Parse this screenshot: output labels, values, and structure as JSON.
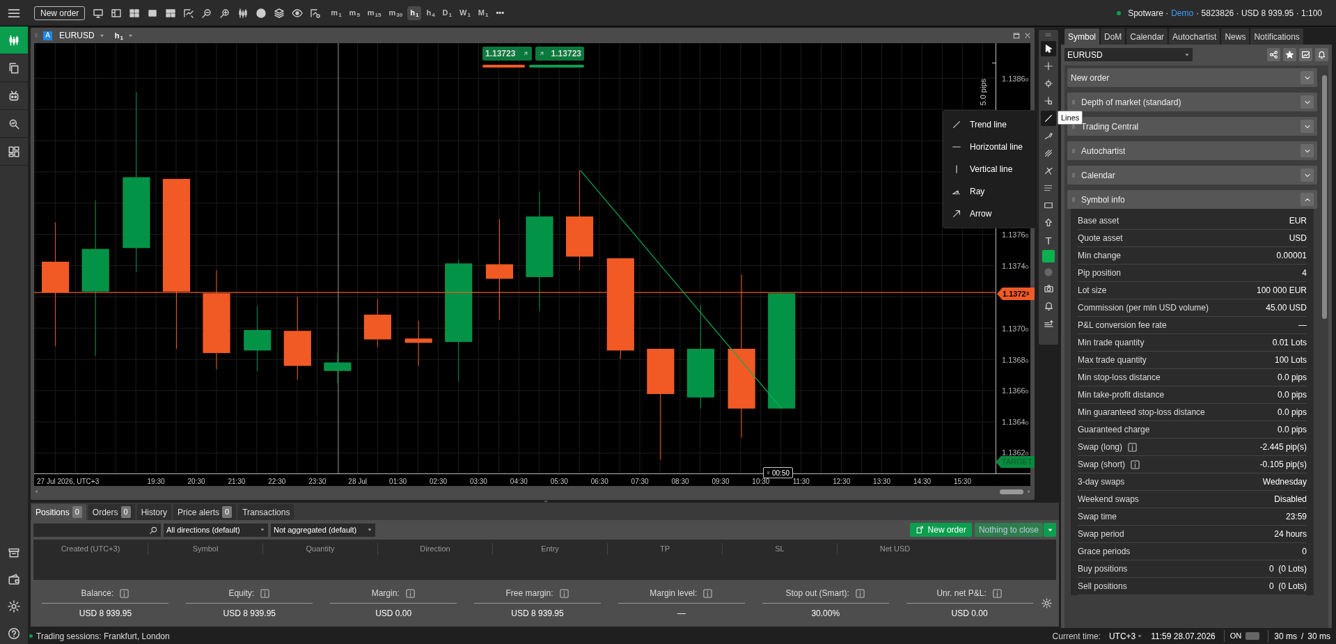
{
  "top_bar": {
    "new_order": "New order",
    "more": "•••",
    "timeframes": [
      {
        "unit": "m",
        "count": "1",
        "selected": false
      },
      {
        "unit": "m",
        "count": "5",
        "selected": false
      },
      {
        "unit": "m",
        "count": "15",
        "selected": false
      },
      {
        "unit": "m",
        "count": "30",
        "selected": false
      },
      {
        "unit": "h",
        "count": "1",
        "selected": true
      },
      {
        "unit": "h",
        "count": "4",
        "selected": false
      },
      {
        "unit": "D",
        "count": "1",
        "selected": false
      },
      {
        "unit": "W",
        "count": "1",
        "selected": false
      },
      {
        "unit": "M",
        "count": "1",
        "selected": false
      }
    ],
    "account": {
      "broker": "Spotware ·",
      "mode": "Demo",
      "details": "· 5823826 · USD 8 939.95 · 1:100"
    }
  },
  "sidebar": {
    "items": [
      {
        "selected": true
      },
      {
        "selected": false
      },
      {
        "selected": false
      },
      {
        "selected": false
      },
      {
        "selected": false
      }
    ]
  },
  "chart": {
    "symbol_badge": "A",
    "symbol": "EURUSD",
    "timeframe": {
      "unit": "h",
      "count": "1"
    },
    "sell_price": "1.13723",
    "buy_price": "1.13723",
    "range_label": "5.0 pips",
    "current_price": "1.13723",
    "target": "TARGET",
    "countdown": "00:50",
    "price_labels": [
      "1.13860",
      "1.13760",
      "1.13740",
      "1.13700",
      "1.13680",
      "1.13660",
      "1.13640",
      "1.13620"
    ],
    "date_label": "27 Jul 2026, UTC+3",
    "time_labels": [
      "19:30",
      "20:30",
      "21:30",
      "22:30",
      "23:30",
      "28 Jul",
      "01:30",
      "02:30",
      "03:30",
      "04:30",
      "05:30",
      "06:30",
      "07:30",
      "08:30",
      "09:30",
      "10:30",
      "11:30",
      "12:30",
      "13:30",
      "14:30",
      "15:30"
    ],
    "drawing_menu": [
      {
        "label": "Trend line",
        "kind": "trend"
      },
      {
        "label": "Horizontal line",
        "kind": "horizontal"
      },
      {
        "label": "Vertical line",
        "kind": "vertical"
      },
      {
        "label": "Ray",
        "kind": "ray"
      },
      {
        "label": "Arrow",
        "kind": "arrow"
      }
    ],
    "tooltip": "Lines"
  },
  "drawing_tools": {
    "text_tool": "T",
    "tools": [
      {
        "selected": true
      },
      {
        "selected": false
      },
      {
        "selected": false
      },
      {
        "selected": false
      },
      {
        "selected": true
      },
      {
        "selected": false
      },
      {
        "selected": false
      },
      {
        "selected": false
      },
      {
        "selected": false
      },
      {
        "selected": false
      },
      {
        "selected": false
      }
    ]
  },
  "right_panel": {
    "tabs": [
      {
        "label": "Symbol",
        "selected": true
      },
      {
        "label": "DoM",
        "selected": false
      },
      {
        "label": "Calendar",
        "selected": false
      },
      {
        "label": "Autochartist",
        "selected": false
      },
      {
        "label": "News",
        "selected": false
      },
      {
        "label": "Notifications",
        "selected": false
      }
    ],
    "symbol_select": "EURUSD",
    "sections": [
      {
        "title": "New order",
        "expanded": false,
        "movable": false
      },
      {
        "title": "Depth of market (standard)",
        "expanded": false,
        "movable": true
      },
      {
        "title": "Trading Central",
        "expanded": false,
        "movable": true
      },
      {
        "title": "Autochartist",
        "expanded": false,
        "movable": true
      },
      {
        "title": "Calendar",
        "expanded": false,
        "movable": true
      },
      {
        "title": "Symbol info",
        "expanded": true,
        "movable": true
      }
    ],
    "symbol_info": [
      {
        "label": "Base asset",
        "value": "EUR",
        "kind": "plain"
      },
      {
        "label": "Quote asset",
        "value": "USD",
        "kind": "plain"
      },
      {
        "label": "Min change",
        "value": "0.00001",
        "kind": "plain"
      },
      {
        "label": "Pip position",
        "value": "4",
        "kind": "plain"
      },
      {
        "label": "Lot size",
        "value": "100 000 EUR",
        "kind": "plain"
      },
      {
        "label": "Commission (per mln USD volume)",
        "value": "45.00 USD",
        "kind": "plain"
      },
      {
        "label": "P&L conversion fee rate",
        "value": "—",
        "kind": "plain"
      },
      {
        "label": "Min trade quantity",
        "value": "0.01 Lots",
        "kind": "plain"
      },
      {
        "label": "Max trade quantity",
        "value": "100 Lots",
        "kind": "plain"
      },
      {
        "label": "Min stop-loss distance",
        "value": "0.0 pips",
        "kind": "plain"
      },
      {
        "label": "Min take-profit distance",
        "value": "0.0 pips",
        "kind": "plain"
      },
      {
        "label": "Min guaranteed stop-loss distance",
        "value": "0.0 pips",
        "kind": "plain"
      },
      {
        "label": "Guaranteed charge",
        "value": "0.0 pips",
        "kind": "plain"
      },
      {
        "label": "Swap (long)",
        "value": "-2.445 pip(s)",
        "kind": "info"
      },
      {
        "label": "Swap (short)",
        "value": "-0.105 pip(s)",
        "kind": "info"
      },
      {
        "label": "3-day swaps",
        "value": "Wednesday",
        "kind": "plain"
      },
      {
        "label": "Weekend swaps",
        "value": "Disabled",
        "kind": "plain"
      },
      {
        "label": "Swap time",
        "value": "23:59",
        "kind": "plain"
      },
      {
        "label": "Swap period",
        "value": "24 hours",
        "kind": "plain"
      },
      {
        "label": "Grace periods",
        "value": "0",
        "kind": "plain"
      },
      {
        "label": "Buy positions",
        "value": "0  (0 Lots)",
        "kind": "plain"
      },
      {
        "label": "Sell positions",
        "value": "0  (0 Lots)",
        "kind": "plain"
      }
    ]
  },
  "bottom_panel": {
    "tabs": [
      {
        "label": "Positions",
        "count": "0",
        "selected": true
      },
      {
        "label": "Orders",
        "count": "0",
        "selected": false
      },
      {
        "label": "History",
        "selected": false
      },
      {
        "label": "Price alerts",
        "count": "0",
        "selected": false
      },
      {
        "label": "Transactions",
        "selected": false
      }
    ],
    "direction_filter": "All directions (default)",
    "aggregation_filter": "Not aggregated (default)",
    "new_order": "New order",
    "close_button": "Nothing to close",
    "columns": [
      "Created (UTC+3)",
      "Symbol",
      "Quantity",
      "Direction",
      "Entry",
      "TP",
      "SL",
      "Net USD"
    ],
    "summary": [
      {
        "label": "Balance:",
        "value": "USD 8 939.95"
      },
      {
        "label": "Equity:",
        "value": "USD 8 939.95"
      },
      {
        "label": "Margin:",
        "value": "USD 0.00"
      },
      {
        "label": "Free margin:",
        "value": "USD 8 939.95"
      },
      {
        "label": "Margin level:",
        "value": "—"
      },
      {
        "label": "Stop out (Smart):",
        "value": "30.00%"
      },
      {
        "label": "Unr. net P&L:",
        "value": "USD 0.00"
      }
    ]
  },
  "status_bar": {
    "sessions": "Trading sessions: Frankfurt, London",
    "time_label": "Current time:",
    "timezone": "UTC+3",
    "time": "11:59 28.07.2026",
    "toggle_label": "ON",
    "toggle_on": false,
    "latency_1": "30 ms",
    "separator": "/",
    "latency_2": "30 ms"
  }
}
